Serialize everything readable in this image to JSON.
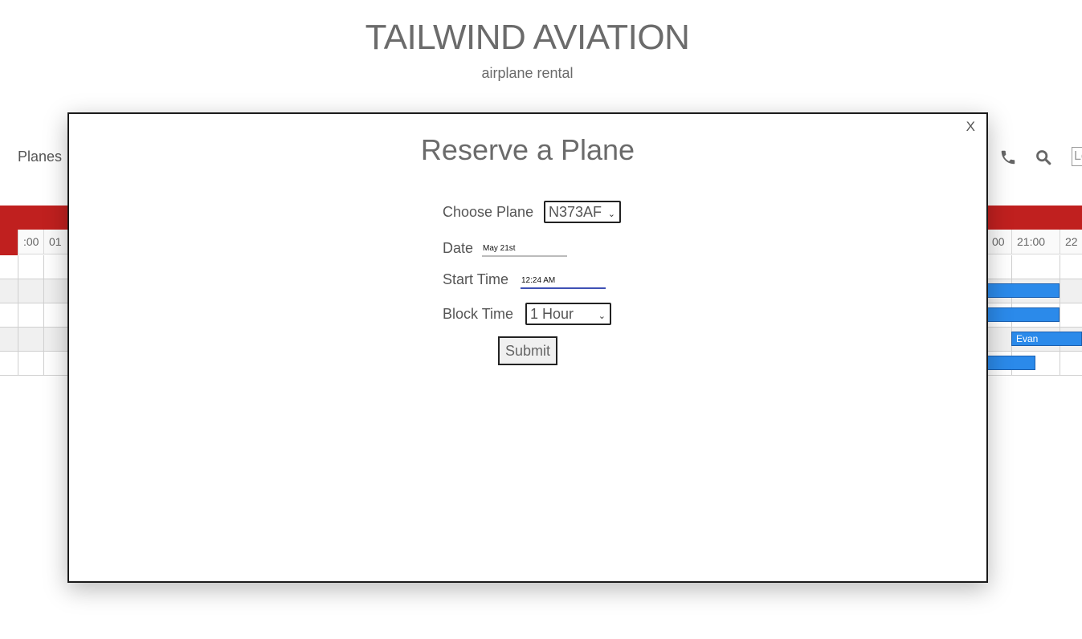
{
  "header": {
    "title": "TAILWIND AVIATION",
    "subtitle": "airplane rental"
  },
  "nav": {
    "planes_label": "Planes",
    "phone_icon": "phone-icon",
    "search_icon": "search-icon",
    "login_label": "Lo"
  },
  "schedule": {
    "left_times": [
      ":00",
      "01"
    ],
    "right_times": [
      "00",
      "21:00",
      "22"
    ],
    "bookings": [
      {
        "pilot": ""
      },
      {
        "pilot": ""
      },
      {
        "pilot": "Evan"
      },
      {
        "pilot": ""
      }
    ],
    "accent_color": "#c0201f",
    "booking_color": "#2b8aea"
  },
  "modal": {
    "close_label": "X",
    "title": "Reserve a Plane",
    "choose_plane_label": "Choose Plane",
    "choose_plane_value": "N373AF",
    "date_label": "Date",
    "date_value": "May 21st",
    "start_time_label": "Start Time",
    "start_time_value": "12:24 AM",
    "block_time_label": "Block Time",
    "block_time_value": "1 Hour",
    "submit_label": "Submit"
  }
}
